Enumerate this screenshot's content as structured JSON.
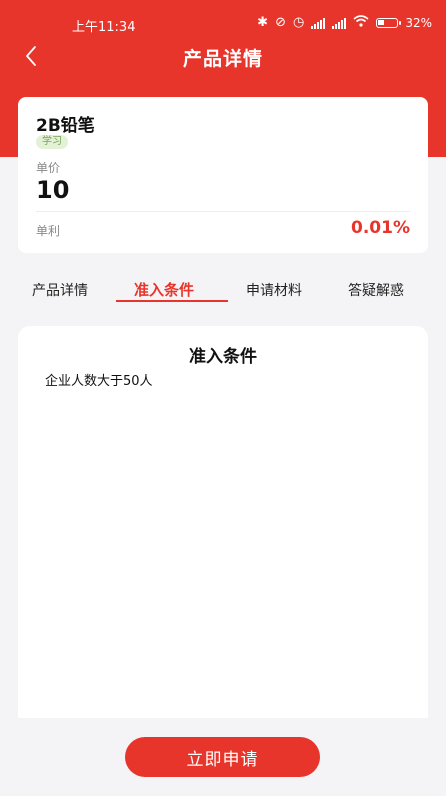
{
  "status_bar": {
    "time": "上午11:34",
    "battery": "32%"
  },
  "nav": {
    "title": "产品详情",
    "back_icon": "chevron-left-icon"
  },
  "product": {
    "name": "2B铅笔",
    "tag": "学习",
    "price_label": "单价",
    "price_value": "10",
    "profit_label": "单利",
    "profit_value": "0.01%"
  },
  "tabs": [
    {
      "label": "产品详情",
      "active": false
    },
    {
      "label": "准入条件",
      "active": true
    },
    {
      "label": "申请材料",
      "active": false
    },
    {
      "label": "答疑解惑",
      "active": false
    }
  ],
  "content": {
    "title": "准入条件",
    "text": "企业人数大于50人"
  },
  "footer": {
    "apply_label": "立即申请"
  },
  "colors": {
    "primary": "#e8352b",
    "background": "#f4f4f6",
    "tag_bg": "#e3f1d6",
    "tag_text": "#7aa35a"
  }
}
